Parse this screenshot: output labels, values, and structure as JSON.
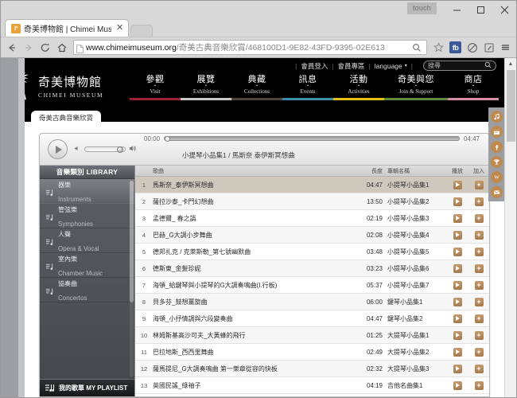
{
  "window": {
    "touch_label": "touch",
    "minimize": "─",
    "maximize": "□",
    "close": "✕"
  },
  "tab": {
    "title": "奇美博物館 | Chimei Mus",
    "close": "✕"
  },
  "toolbar": {
    "back": "←",
    "forward": "→",
    "reload": "C",
    "home": "⌂",
    "url_host": "www.chimeimuseum.org",
    "url_path": "/奇美古典音樂欣賞/468100D1-9E82-43FD-9395-02E613",
    "zoom_icon": "⚲",
    "bookmark_icon": "☆",
    "fb_label": "fb",
    "menu_icon": "☰"
  },
  "site_top": {
    "login": "會員登入",
    "member_area": "會員專區",
    "language": "language",
    "caret": "▾",
    "search_placeholder": "搜尋",
    "separator": "|"
  },
  "logo": {
    "cn": "奇美博物館",
    "en": "CHIMEI MUSEUM"
  },
  "nav": [
    {
      "cn": "參觀",
      "en": "Visit",
      "color": "#9e2235"
    },
    {
      "cn": "展覽",
      "en": "Exhibitions",
      "color": "#c6c6c6"
    },
    {
      "cn": "典藏",
      "en": "Collections",
      "color": "#4e463d"
    },
    {
      "cn": "訊息",
      "en": "Events",
      "color": "#3b8fa8"
    },
    {
      "cn": "活動",
      "en": "Activities",
      "color": "#e0c112"
    },
    {
      "cn": "奇美與您",
      "en": "Join & Support",
      "color": "#5d8a3c"
    },
    {
      "cn": "商店",
      "en": "Shop",
      "color": "#d48fa8"
    }
  ],
  "breadcrumb": {
    "label": "奇美古典音樂欣賞"
  },
  "player": {
    "now_playing": "小提琴小品集1 / 馬斯奈 泰伊斯冥想曲",
    "elapsed": "00:00",
    "duration": "04:47",
    "play_icon": "play-icon",
    "volume_low_icon": "volume-low-icon",
    "volume_high_icon": "volume-high-icon"
  },
  "library": {
    "heading": "音樂類別 LIBRARY",
    "items": [
      {
        "cn": "器樂",
        "en": "Instruments",
        "active": true
      },
      {
        "cn": "管弦樂",
        "en": "Symphonies",
        "active": false
      },
      {
        "cn": "人聲",
        "en": "Opera & Vocal",
        "active": false
      },
      {
        "cn": "室內樂",
        "en": "Chamber Music",
        "active": false
      },
      {
        "cn": "協奏曲",
        "en": "Concertos",
        "active": false
      }
    ],
    "playlist_label": "我的歌單 MY PLAYLIST"
  },
  "table": {
    "headers": {
      "num": "",
      "song": "歌曲",
      "length": "長度",
      "album": "專輯名稱",
      "play": "播放",
      "add": "加入"
    },
    "rows": [
      {
        "num": "1",
        "song": "馬斯奈_泰伊斯冥想曲",
        "length": "04:47",
        "album": "小提琴小品集1",
        "selected": true
      },
      {
        "num": "2",
        "song": "薩拉沙泰_卡門幻想曲",
        "length": "13:50",
        "album": "小提琴小品集2",
        "selected": false
      },
      {
        "num": "3",
        "song": "孟德爾_ 春之譌",
        "length": "02:19",
        "album": "小提琴小品集3",
        "selected": false
      },
      {
        "num": "4",
        "song": "巴赫_G大調小步舞曲",
        "length": "02:08",
        "album": "小提琴小品集4",
        "selected": false
      },
      {
        "num": "5",
        "song": "德邦扎克 / 克萊斯勒_第七號幽默曲",
        "length": "03:48",
        "album": "小提琴小品集5",
        "selected": false
      },
      {
        "num": "6",
        "song": "德斯東_金髮珍妮",
        "length": "03:23",
        "album": "小提琴小品集6",
        "selected": false
      },
      {
        "num": "7",
        "song": "海頓_給鍵琴與小提琴的G大調奏鳴曲(I.行板)",
        "length": "05:37",
        "album": "小提琴小品集7",
        "selected": false
      },
      {
        "num": "8",
        "song": "貝多芬_鼓想薑旋曲",
        "length": "06:00",
        "album": "鍵琴小品集1",
        "selected": false
      },
      {
        "num": "9",
        "song": "海頓_小抒情調與六段變奏曲",
        "length": "04:47",
        "album": "鍵琴小品集2",
        "selected": false
      },
      {
        "num": "10",
        "song": "林姆斯基高沙可夫_大黃蜂的飛行",
        "length": "01:25",
        "album": "大提琴小品集1",
        "selected": false
      },
      {
        "num": "11",
        "song": "巴拉地斯_西西里舞曲",
        "length": "02:49",
        "album": "大提琴小品集2",
        "selected": false
      },
      {
        "num": "12",
        "song": "薩馬提尼_G大調奏鳴曲 第一樂章從容的快板",
        "length": "02:32",
        "album": "大提琴小品集3",
        "selected": false
      },
      {
        "num": "13",
        "song": "英國民謠_綠袖子",
        "length": "04:19",
        "album": "吉他名曲集1",
        "selected": false
      }
    ]
  },
  "social_rail": [
    {
      "icon": "music-note-icon",
      "glyph": "♪"
    },
    {
      "icon": "calendar-icon",
      "glyph": "▦"
    },
    {
      "icon": "facebook-icon",
      "glyph": "f"
    },
    {
      "icon": "trophy-icon",
      "glyph": "☘"
    },
    {
      "icon": "shop-icon",
      "glyph": "W"
    },
    {
      "icon": "mail-icon",
      "glyph": "✉"
    }
  ]
}
